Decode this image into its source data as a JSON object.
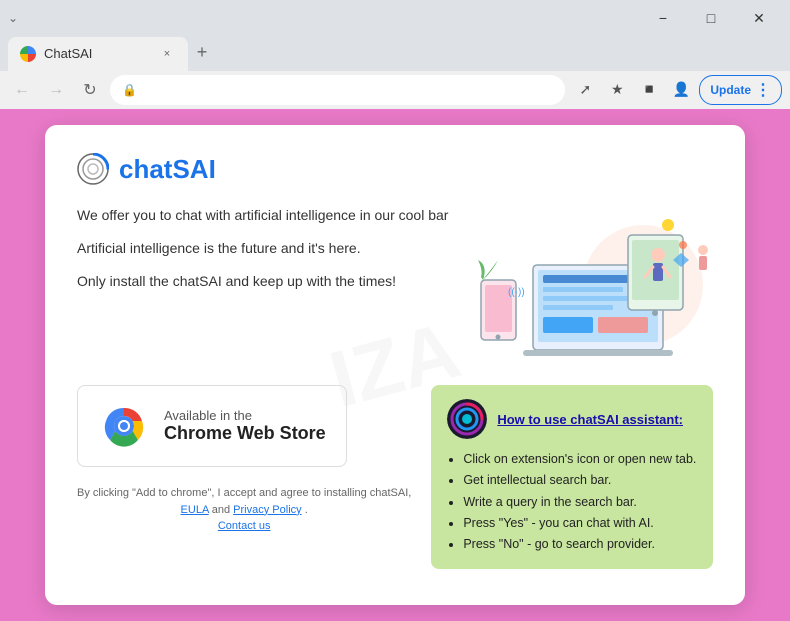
{
  "browser": {
    "tab_title": "ChatSAI",
    "tab_close_label": "×",
    "new_tab_label": "+",
    "nav_back_label": "←",
    "nav_forward_label": "→",
    "nav_refresh_label": "↻",
    "update_button_label": "Update",
    "update_menu_label": "⋮"
  },
  "page": {
    "brand_name": "chatSAI",
    "descriptions": [
      "We offer you to chat with artificial intelligence in our cool bar",
      "Artificial intelligence is the future and it's here.",
      "Only install the chatSAI and keep up with the times!"
    ],
    "chrome_store": {
      "available_text": "Available in the",
      "store_name": "Chrome Web Store"
    },
    "legal": {
      "text": "By clicking \"Add to chrome\", I accept and agree to installing chatSAI,",
      "eula_label": "EULA",
      "and_text": " and ",
      "privacy_label": "Privacy Policy",
      "period": ".",
      "contact_label": "Contact us"
    },
    "how_to": {
      "title": "How to use chatSAI assistant:",
      "steps": [
        "Click on extension's icon or open new tab.",
        "Get intellectual search bar.",
        "Write a query in the search bar.",
        "Press \"Yes\" - you can chat with AI.",
        "Press \"No\" - go to search provider."
      ]
    },
    "watermark": "IZA"
  }
}
